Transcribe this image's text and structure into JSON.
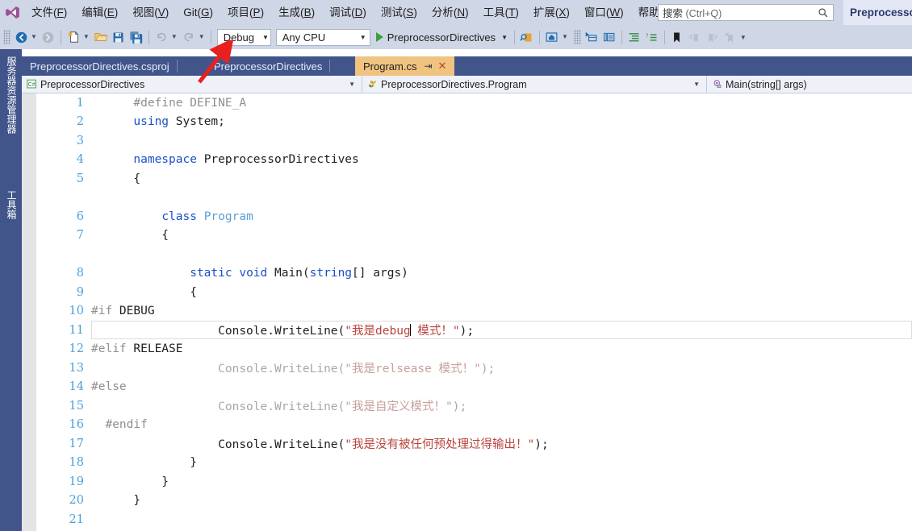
{
  "app": {
    "title": "Preprocessor",
    "logo_icon": "visual-studio-logo"
  },
  "menu": {
    "items": [
      {
        "label": "文件(F)",
        "mnemonic": "F"
      },
      {
        "label": "编辑(E)",
        "mnemonic": "E"
      },
      {
        "label": "视图(V)",
        "mnemonic": "V"
      },
      {
        "label": "Git(G)",
        "mnemonic": "G"
      },
      {
        "label": "项目(P)",
        "mnemonic": "P"
      },
      {
        "label": "生成(B)",
        "mnemonic": "B"
      },
      {
        "label": "调试(D)",
        "mnemonic": "D"
      },
      {
        "label": "测试(S)",
        "mnemonic": "S"
      },
      {
        "label": "分析(N)",
        "mnemonic": "N"
      },
      {
        "label": "工具(T)",
        "mnemonic": "T"
      },
      {
        "label": "扩展(X)",
        "mnemonic": "X"
      },
      {
        "label": "窗口(W)",
        "mnemonic": "W"
      },
      {
        "label": "帮助(H)",
        "mnemonic": "H"
      }
    ]
  },
  "search": {
    "label": "搜索",
    "hint": "(Ctrl+Q)",
    "icon": "search-icon"
  },
  "toolbar": {
    "back_icon": "navigate-back-icon",
    "forward_icon": "navigate-forward-icon",
    "new_item_icon": "new-item-icon",
    "open_icon": "open-folder-icon",
    "save_icon": "save-icon",
    "save_all_icon": "save-all-icon",
    "undo_icon": "undo-icon",
    "redo_icon": "redo-icon",
    "configuration": "Debug",
    "platform": "Any CPU",
    "start_label": "PreprocessorDirectives",
    "start_icon": "run-play-icon",
    "find_icon": "find-in-files-icon",
    "preview_icon": "preview-selected-items-icon",
    "select_icon": "solution-explorer-icon",
    "properties_icon": "properties-window-icon",
    "indent_icon": "indent-icon",
    "comment_icon": "comment-icon",
    "bookmark_icon": "bookmark-icon",
    "prev_bookmark_icon": "previous-bookmark-icon",
    "next_bookmark_icon": "next-bookmark-icon",
    "clear_bookmark_icon": "clear-bookmarks-icon",
    "overflow_icon": "toolbar-overflow-icon"
  },
  "leftdock": {
    "tabs": [
      {
        "label": "服务器资源管理器"
      },
      {
        "label": "工具箱"
      }
    ]
  },
  "tabs": [
    {
      "label": "PreprocessorDirectives.csproj",
      "active": false
    },
    {
      "label": "PreprocessorDirectives",
      "active": false
    },
    {
      "label": "Program.cs",
      "active": true,
      "pin_icon": "pin-icon",
      "close_icon": "close-icon"
    }
  ],
  "navbar": {
    "project": "PreprocessorDirectives",
    "project_icon": "csharp-project-icon",
    "type": "PreprocessorDirectives.Program",
    "type_icon": "class-icon",
    "member": "Main(string[] args)",
    "member_icon": "method-private-icon",
    "dropdown_icon": "chevron-down-icon"
  },
  "editor": {
    "current_line": 11,
    "cursor_after": "debug",
    "colors": {
      "keyword": "#1b4fc6",
      "type": "#5c9fd6",
      "string": "#b9443c",
      "preprocessor": "#8f8f8f",
      "inactive": "#a8a8a8",
      "linenumber": "#4aa0dd"
    },
    "lines": [
      {
        "n": "1",
        "tokens": [
          {
            "t": "      ",
            "c": "plain"
          },
          {
            "t": "#define DEFINE_A",
            "c": "pp"
          }
        ]
      },
      {
        "n": "2",
        "tokens": [
          {
            "t": "      ",
            "c": "plain"
          },
          {
            "t": "using",
            "c": "kw"
          },
          {
            "t": " System;",
            "c": "plain"
          }
        ]
      },
      {
        "n": "3",
        "tokens": []
      },
      {
        "n": "4",
        "tokens": [
          {
            "t": "      ",
            "c": "plain"
          },
          {
            "t": "namespace",
            "c": "kw"
          },
          {
            "t": " PreprocessorDirectives",
            "c": "plain"
          }
        ]
      },
      {
        "n": "5",
        "tokens": [
          {
            "t": "      {",
            "c": "plain"
          }
        ]
      },
      {
        "n": "",
        "tokens": []
      },
      {
        "n": "6",
        "tokens": [
          {
            "t": "          ",
            "c": "plain"
          },
          {
            "t": "class",
            "c": "kw"
          },
          {
            "t": " ",
            "c": "plain"
          },
          {
            "t": "Program",
            "c": "type"
          }
        ]
      },
      {
        "n": "7",
        "tokens": [
          {
            "t": "          {",
            "c": "plain"
          }
        ]
      },
      {
        "n": "",
        "tokens": []
      },
      {
        "n": "8",
        "tokens": [
          {
            "t": "              ",
            "c": "plain"
          },
          {
            "t": "static",
            "c": "kw"
          },
          {
            "t": " ",
            "c": "plain"
          },
          {
            "t": "void",
            "c": "kw"
          },
          {
            "t": " Main(",
            "c": "plain"
          },
          {
            "t": "string",
            "c": "kw"
          },
          {
            "t": "[] args)",
            "c": "plain"
          }
        ]
      },
      {
        "n": "9",
        "tokens": [
          {
            "t": "              {",
            "c": "plain"
          }
        ]
      },
      {
        "n": "10",
        "tokens": [
          {
            "t": "#if",
            "c": "pp"
          },
          {
            "t": " DEBUG",
            "c": "plain"
          }
        ]
      },
      {
        "n": "11",
        "tokens": [
          {
            "t": "                  Console.WriteLine(",
            "c": "plain"
          },
          {
            "t": "\"我是debug",
            "c": "str"
          },
          {
            "t": "CARET",
            "c": "caret"
          },
          {
            "t": " 模式！\"",
            "c": "str"
          },
          {
            "t": ");",
            "c": "plain"
          }
        ],
        "current": true
      },
      {
        "n": "12",
        "tokens": [
          {
            "t": "#elif",
            "c": "pp"
          },
          {
            "t": " RELEASE",
            "c": "plain"
          }
        ]
      },
      {
        "n": "13",
        "tokens": [
          {
            "t": "                  Console.WriteLine(",
            "c": "dim"
          },
          {
            "t": "\"我是relsease 模式！\"",
            "c": "dimstr"
          },
          {
            "t": ");",
            "c": "dim"
          }
        ]
      },
      {
        "n": "14",
        "tokens": [
          {
            "t": "#else",
            "c": "pp"
          }
        ]
      },
      {
        "n": "15",
        "tokens": [
          {
            "t": "                  Console.WriteLine(",
            "c": "dim"
          },
          {
            "t": "\"我是自定义模式！\"",
            "c": "dimstr"
          },
          {
            "t": ");",
            "c": "dim"
          }
        ]
      },
      {
        "n": "16",
        "tokens": [
          {
            "t": "  #endif",
            "c": "pp"
          }
        ]
      },
      {
        "n": "17",
        "tokens": [
          {
            "t": "                  Console.WriteLine(",
            "c": "plain"
          },
          {
            "t": "\"我是没有被任何预处理过得输出！\"",
            "c": "str"
          },
          {
            "t": ");",
            "c": "plain"
          }
        ]
      },
      {
        "n": "18",
        "tokens": [
          {
            "t": "              }",
            "c": "plain"
          }
        ]
      },
      {
        "n": "19",
        "tokens": [
          {
            "t": "          }",
            "c": "plain"
          }
        ]
      },
      {
        "n": "20",
        "tokens": [
          {
            "t": "      }",
            "c": "plain"
          }
        ]
      },
      {
        "n": "21",
        "tokens": []
      }
    ]
  },
  "annotation": {
    "arrow_color": "#e8201e",
    "arrow_target": "Debug configuration dropdown"
  }
}
